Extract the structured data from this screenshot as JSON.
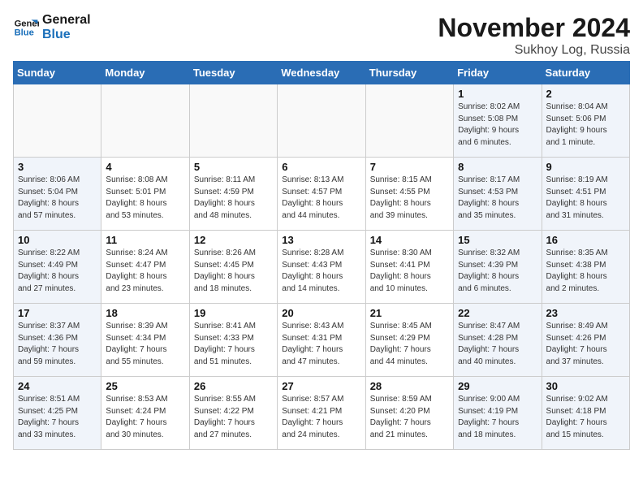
{
  "logo": {
    "line1": "General",
    "line2": "Blue"
  },
  "title": "November 2024",
  "location": "Sukhoy Log, Russia",
  "weekdays": [
    "Sunday",
    "Monday",
    "Tuesday",
    "Wednesday",
    "Thursday",
    "Friday",
    "Saturday"
  ],
  "weeks": [
    [
      {
        "day": "",
        "info": "",
        "type": "empty"
      },
      {
        "day": "",
        "info": "",
        "type": "empty"
      },
      {
        "day": "",
        "info": "",
        "type": "empty"
      },
      {
        "day": "",
        "info": "",
        "type": "empty"
      },
      {
        "day": "",
        "info": "",
        "type": "empty"
      },
      {
        "day": "1",
        "info": "Sunrise: 8:02 AM\nSunset: 5:08 PM\nDaylight: 9 hours\nand 6 minutes.",
        "type": "weekend"
      },
      {
        "day": "2",
        "info": "Sunrise: 8:04 AM\nSunset: 5:06 PM\nDaylight: 9 hours\nand 1 minute.",
        "type": "weekend"
      }
    ],
    [
      {
        "day": "3",
        "info": "Sunrise: 8:06 AM\nSunset: 5:04 PM\nDaylight: 8 hours\nand 57 minutes.",
        "type": "weekend"
      },
      {
        "day": "4",
        "info": "Sunrise: 8:08 AM\nSunset: 5:01 PM\nDaylight: 8 hours\nand 53 minutes.",
        "type": "weekday"
      },
      {
        "day": "5",
        "info": "Sunrise: 8:11 AM\nSunset: 4:59 PM\nDaylight: 8 hours\nand 48 minutes.",
        "type": "weekday"
      },
      {
        "day": "6",
        "info": "Sunrise: 8:13 AM\nSunset: 4:57 PM\nDaylight: 8 hours\nand 44 minutes.",
        "type": "weekday"
      },
      {
        "day": "7",
        "info": "Sunrise: 8:15 AM\nSunset: 4:55 PM\nDaylight: 8 hours\nand 39 minutes.",
        "type": "weekday"
      },
      {
        "day": "8",
        "info": "Sunrise: 8:17 AM\nSunset: 4:53 PM\nDaylight: 8 hours\nand 35 minutes.",
        "type": "weekend"
      },
      {
        "day": "9",
        "info": "Sunrise: 8:19 AM\nSunset: 4:51 PM\nDaylight: 8 hours\nand 31 minutes.",
        "type": "weekend"
      }
    ],
    [
      {
        "day": "10",
        "info": "Sunrise: 8:22 AM\nSunset: 4:49 PM\nDaylight: 8 hours\nand 27 minutes.",
        "type": "weekend"
      },
      {
        "day": "11",
        "info": "Sunrise: 8:24 AM\nSunset: 4:47 PM\nDaylight: 8 hours\nand 23 minutes.",
        "type": "weekday"
      },
      {
        "day": "12",
        "info": "Sunrise: 8:26 AM\nSunset: 4:45 PM\nDaylight: 8 hours\nand 18 minutes.",
        "type": "weekday"
      },
      {
        "day": "13",
        "info": "Sunrise: 8:28 AM\nSunset: 4:43 PM\nDaylight: 8 hours\nand 14 minutes.",
        "type": "weekday"
      },
      {
        "day": "14",
        "info": "Sunrise: 8:30 AM\nSunset: 4:41 PM\nDaylight: 8 hours\nand 10 minutes.",
        "type": "weekday"
      },
      {
        "day": "15",
        "info": "Sunrise: 8:32 AM\nSunset: 4:39 PM\nDaylight: 8 hours\nand 6 minutes.",
        "type": "weekend"
      },
      {
        "day": "16",
        "info": "Sunrise: 8:35 AM\nSunset: 4:38 PM\nDaylight: 8 hours\nand 2 minutes.",
        "type": "weekend"
      }
    ],
    [
      {
        "day": "17",
        "info": "Sunrise: 8:37 AM\nSunset: 4:36 PM\nDaylight: 7 hours\nand 59 minutes.",
        "type": "weekend"
      },
      {
        "day": "18",
        "info": "Sunrise: 8:39 AM\nSunset: 4:34 PM\nDaylight: 7 hours\nand 55 minutes.",
        "type": "weekday"
      },
      {
        "day": "19",
        "info": "Sunrise: 8:41 AM\nSunset: 4:33 PM\nDaylight: 7 hours\nand 51 minutes.",
        "type": "weekday"
      },
      {
        "day": "20",
        "info": "Sunrise: 8:43 AM\nSunset: 4:31 PM\nDaylight: 7 hours\nand 47 minutes.",
        "type": "weekday"
      },
      {
        "day": "21",
        "info": "Sunrise: 8:45 AM\nSunset: 4:29 PM\nDaylight: 7 hours\nand 44 minutes.",
        "type": "weekday"
      },
      {
        "day": "22",
        "info": "Sunrise: 8:47 AM\nSunset: 4:28 PM\nDaylight: 7 hours\nand 40 minutes.",
        "type": "weekend"
      },
      {
        "day": "23",
        "info": "Sunrise: 8:49 AM\nSunset: 4:26 PM\nDaylight: 7 hours\nand 37 minutes.",
        "type": "weekend"
      }
    ],
    [
      {
        "day": "24",
        "info": "Sunrise: 8:51 AM\nSunset: 4:25 PM\nDaylight: 7 hours\nand 33 minutes.",
        "type": "weekend"
      },
      {
        "day": "25",
        "info": "Sunrise: 8:53 AM\nSunset: 4:24 PM\nDaylight: 7 hours\nand 30 minutes.",
        "type": "weekday"
      },
      {
        "day": "26",
        "info": "Sunrise: 8:55 AM\nSunset: 4:22 PM\nDaylight: 7 hours\nand 27 minutes.",
        "type": "weekday"
      },
      {
        "day": "27",
        "info": "Sunrise: 8:57 AM\nSunset: 4:21 PM\nDaylight: 7 hours\nand 24 minutes.",
        "type": "weekday"
      },
      {
        "day": "28",
        "info": "Sunrise: 8:59 AM\nSunset: 4:20 PM\nDaylight: 7 hours\nand 21 minutes.",
        "type": "weekday"
      },
      {
        "day": "29",
        "info": "Sunrise: 9:00 AM\nSunset: 4:19 PM\nDaylight: 7 hours\nand 18 minutes.",
        "type": "weekend"
      },
      {
        "day": "30",
        "info": "Sunrise: 9:02 AM\nSunset: 4:18 PM\nDaylight: 7 hours\nand 15 minutes.",
        "type": "weekend"
      }
    ]
  ]
}
